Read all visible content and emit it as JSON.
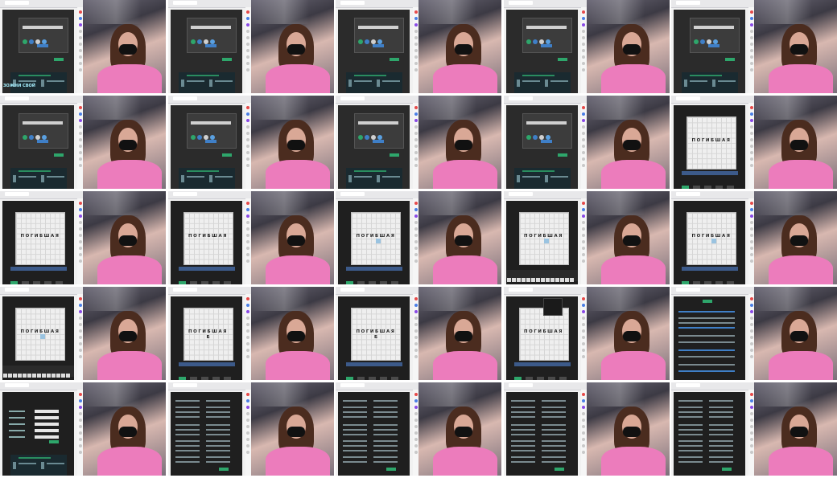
{
  "sheet": {
    "rows": 5,
    "columns": 5,
    "frames": [
      {
        "row": 1,
        "col": 1,
        "screen": "invite-modal",
        "overlay_text": "ЗОЖНИ СВОЙ"
      },
      {
        "row": 1,
        "col": 2,
        "screen": "invite-modal"
      },
      {
        "row": 1,
        "col": 3,
        "screen": "invite-modal"
      },
      {
        "row": 1,
        "col": 4,
        "screen": "invite-modal"
      },
      {
        "row": 1,
        "col": 5,
        "screen": "invite-modal"
      },
      {
        "row": 2,
        "col": 1,
        "screen": "invite-modal"
      },
      {
        "row": 2,
        "col": 2,
        "screen": "invite-modal"
      },
      {
        "row": 2,
        "col": 3,
        "screen": "invite-modal"
      },
      {
        "row": 2,
        "col": 4,
        "screen": "invite-modal"
      },
      {
        "row": 2,
        "col": 5,
        "screen": "board",
        "word": "ПОГИБШАЯ"
      },
      {
        "row": 3,
        "col": 1,
        "screen": "board",
        "word": "ПОГИБШАЯ"
      },
      {
        "row": 3,
        "col": 2,
        "screen": "board",
        "word": "ПОГИБШАЯ"
      },
      {
        "row": 3,
        "col": 3,
        "screen": "board",
        "word": "ПОГИБШАЯ"
      },
      {
        "row": 3,
        "col": 4,
        "screen": "board-keyboard",
        "word": "ПОГИБШАЯ"
      },
      {
        "row": 3,
        "col": 5,
        "screen": "board",
        "word": "ПОГИБШАЯ"
      },
      {
        "row": 4,
        "col": 1,
        "screen": "board-keyboard",
        "word": "ПОГИБШАЯ"
      },
      {
        "row": 4,
        "col": 2,
        "screen": "board",
        "word": "ПОГИБШАЯ",
        "word2": "Б"
      },
      {
        "row": 4,
        "col": 3,
        "screen": "board",
        "word": "ПОГИБШАЯ",
        "word2": "Б"
      },
      {
        "row": 4,
        "col": 4,
        "screen": "board-menu",
        "word": "ПОГИБШАЯ"
      },
      {
        "row": 4,
        "col": 5,
        "screen": "list-page"
      },
      {
        "row": 5,
        "col": 1,
        "screen": "form-page"
      },
      {
        "row": 5,
        "col": 2,
        "screen": "options-page"
      },
      {
        "row": 5,
        "col": 3,
        "screen": "options-page"
      },
      {
        "row": 5,
        "col": 4,
        "screen": "options-page"
      },
      {
        "row": 5,
        "col": 5,
        "screen": "options-page"
      }
    ]
  },
  "colors": {
    "accent_green": "#2ea66b",
    "accent_blue": "#3f7fc7",
    "sweater_pink": "#ec7cbc",
    "app_dark": "#2b2b2b"
  }
}
